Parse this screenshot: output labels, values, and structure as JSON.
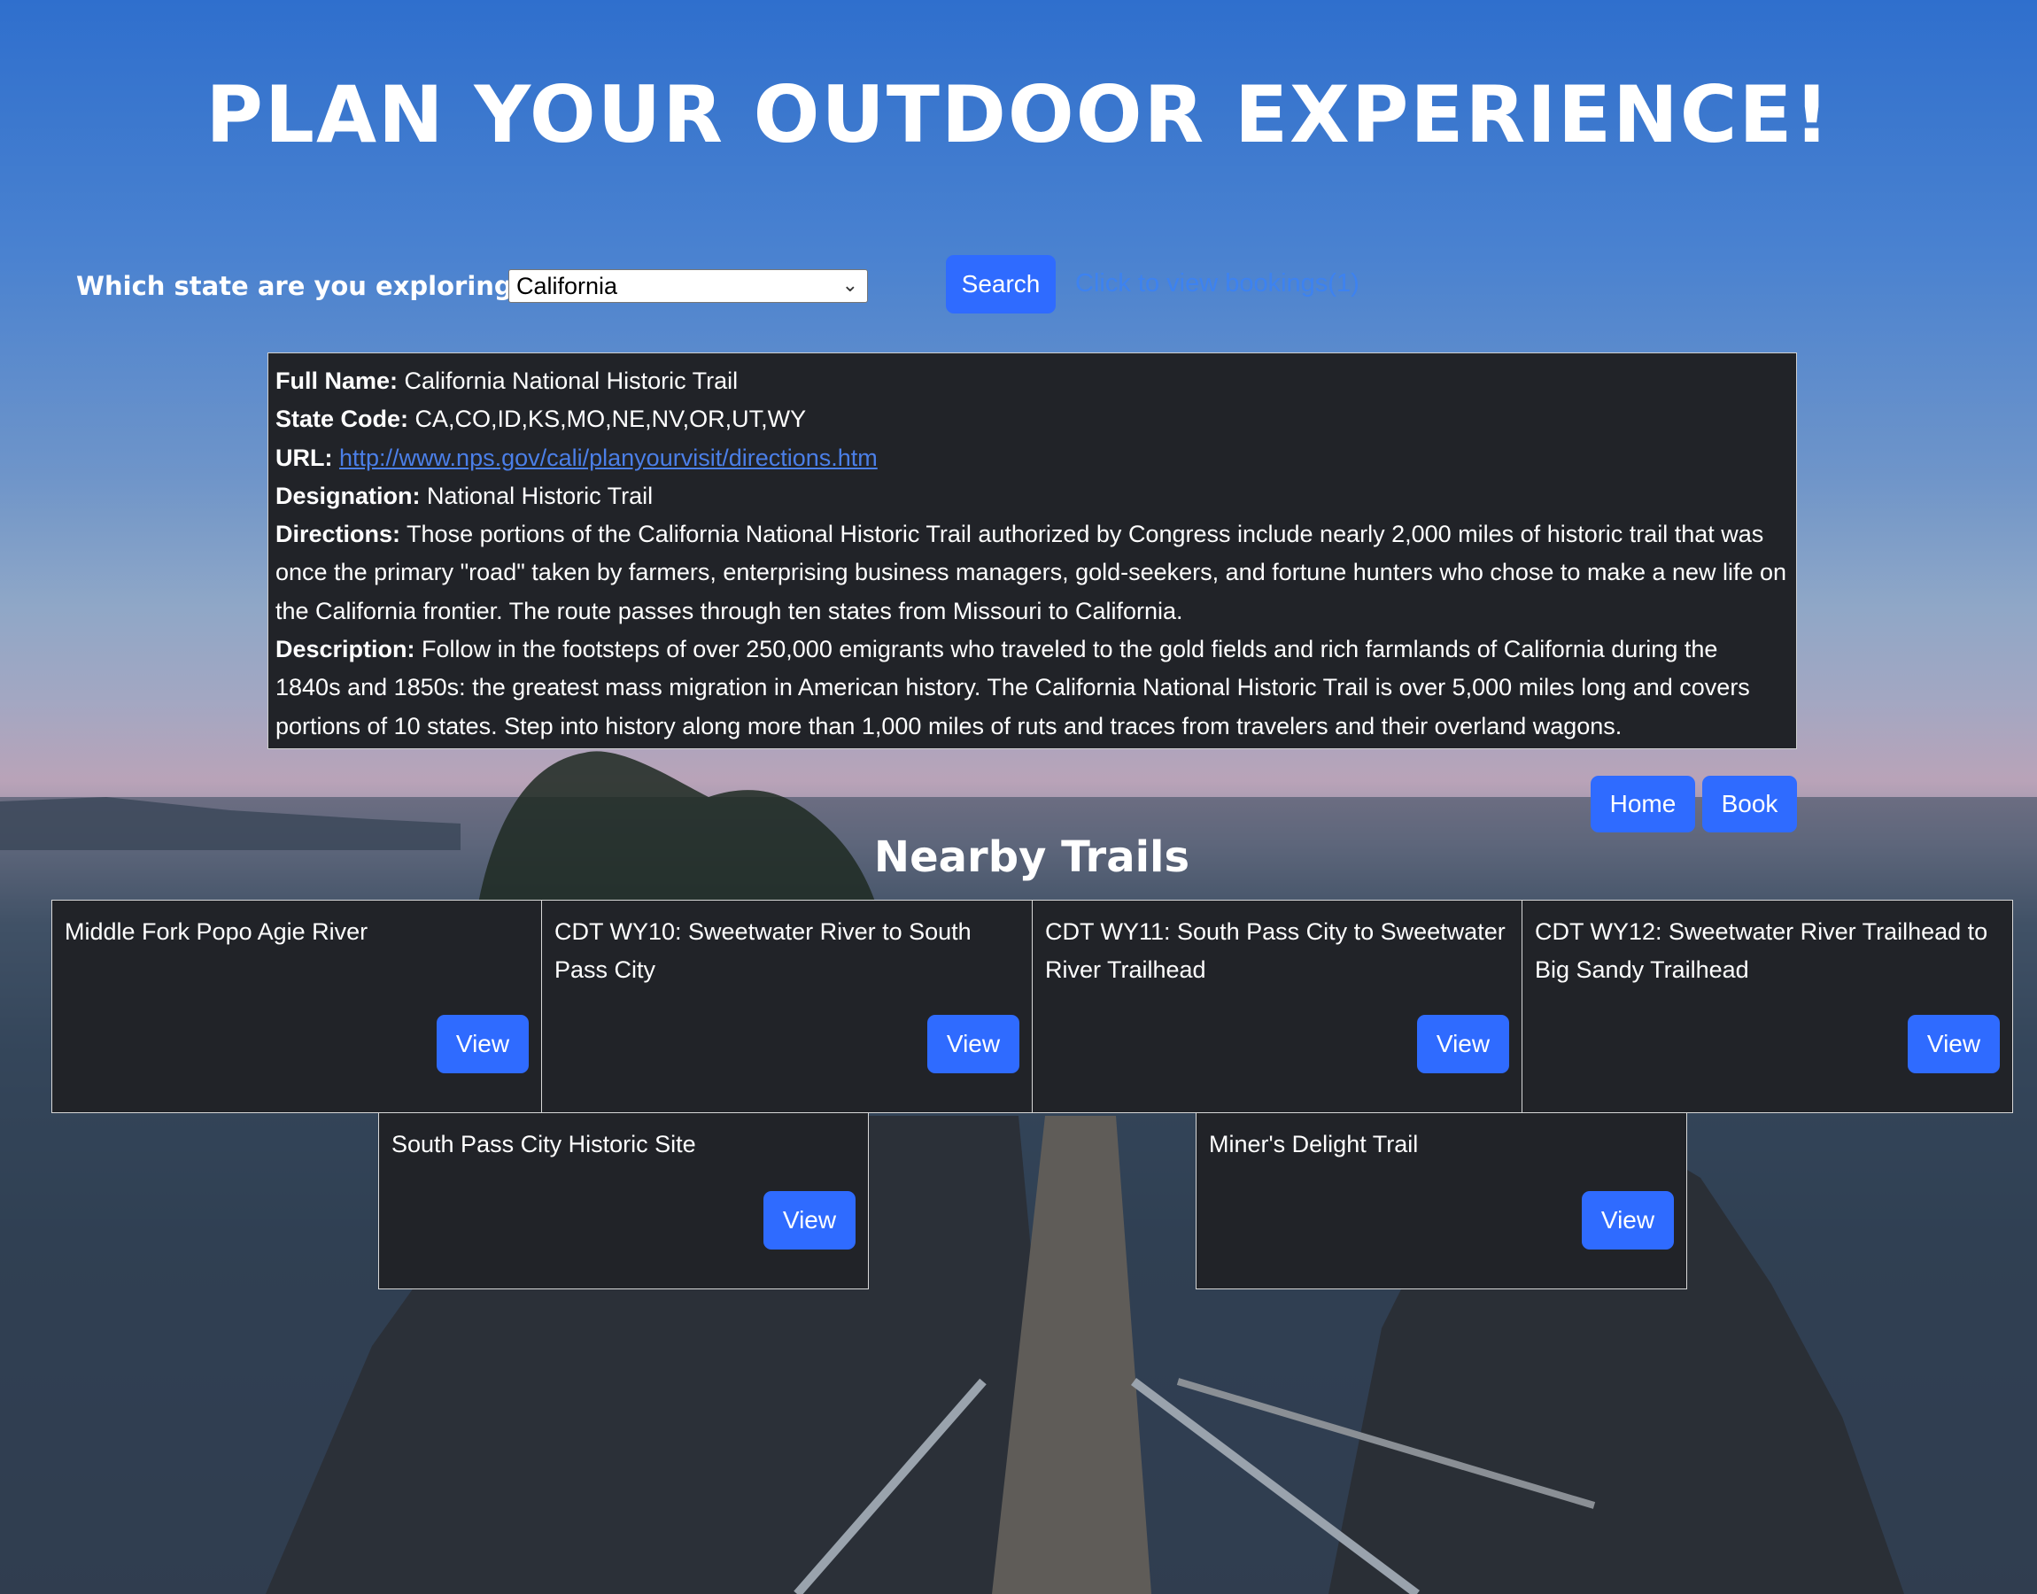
{
  "page": {
    "title": "PLAN YOUR OUTDOOR EXPERIENCE!"
  },
  "search": {
    "label": "Which state are you exploring?",
    "selected_state": "California",
    "button_label": "Search",
    "bookings_link": "Click to view bookings(1)"
  },
  "park": {
    "full_name_label": "Full Name:",
    "full_name": "California National Historic Trail",
    "state_code_label": "State Code:",
    "state_code": "CA,CO,ID,KS,MO,NE,NV,OR,UT,WY",
    "url_label": "URL:",
    "url": "http://www.nps.gov/cali/planyourvisit/directions.htm",
    "designation_label": "Designation:",
    "designation": "National Historic Trail",
    "directions_label": "Directions:",
    "directions": "Those portions of the California National Historic Trail authorized by Congress include nearly 2,000 miles of historic trail that was once the primary \"road\" taken by farmers, enterprising business managers, gold-seekers, and fortune hunters who chose to make a new life on the California frontier. The route passes through ten states from Missouri to California.",
    "description_label": "Description:",
    "description": "Follow in the footsteps of over 250,000 emigrants who traveled to the gold fields and rich farmlands of California during the 1840s and 1850s: the greatest mass migration in American history. The California National Historic Trail is over 5,000 miles long and covers portions of 10 states. Step into history along more than 1,000 miles of ruts and traces from travelers and their overland wagons."
  },
  "actions": {
    "home_label": "Home",
    "book_label": "Book"
  },
  "nearby": {
    "heading": "Nearby Trails",
    "view_label": "View",
    "trails": [
      {
        "name": "Middle Fork Popo Agie River"
      },
      {
        "name": "CDT WY10: Sweetwater River to South Pass City"
      },
      {
        "name": "CDT WY11: South Pass City to Sweetwater River Trailhead"
      },
      {
        "name": "CDT WY12: Sweetwater River Trailhead to Big Sandy Trailhead"
      },
      {
        "name": "South Pass City Historic Site"
      },
      {
        "name": "Miner's Delight Trail"
      }
    ]
  }
}
